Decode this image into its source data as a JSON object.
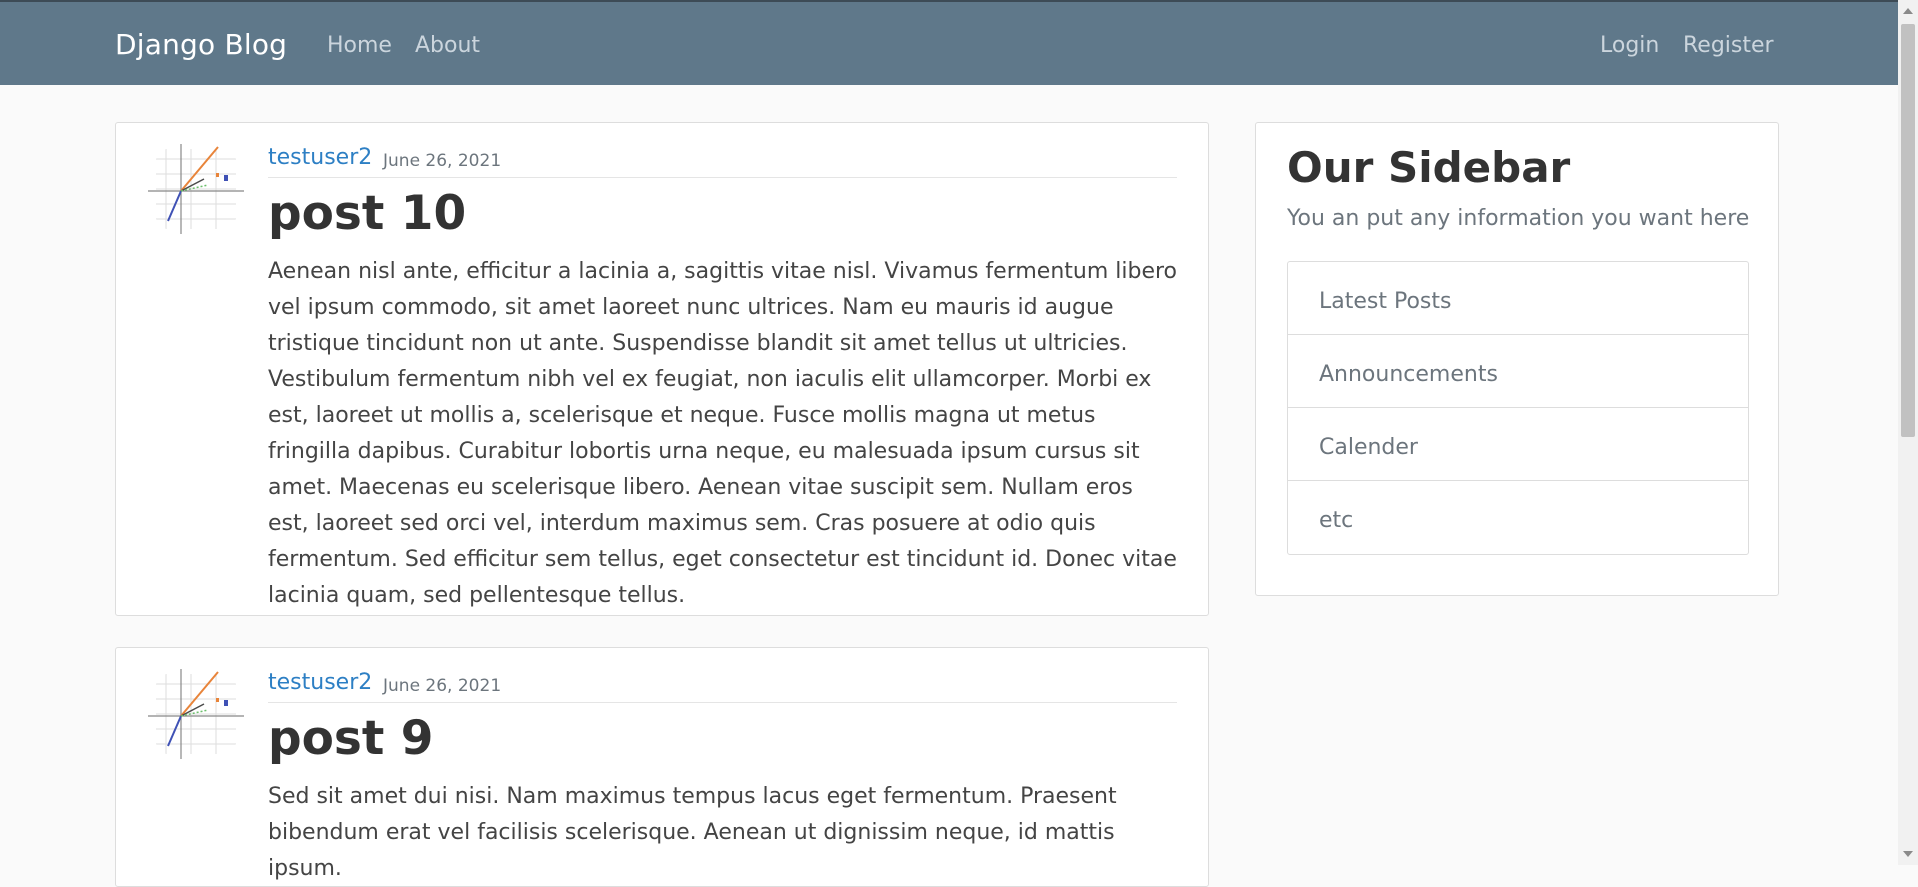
{
  "navbar": {
    "brand": "Django Blog",
    "links": [
      "Home",
      "About"
    ],
    "auth_links": [
      "Login",
      "Register"
    ]
  },
  "posts": [
    {
      "author": "testuser2",
      "date": "June 26, 2021",
      "title": "post 10",
      "content": "Aenean nisl ante, efficitur a lacinia a, sagittis vitae nisl. Vivamus fermentum libero vel ipsum commodo, sit amet laoreet nunc ultrices. Nam eu mauris id augue tristique tincidunt non ut ante. Suspendisse blandit sit amet tellus ut ultricies. Vestibulum fermentum nibh vel ex feugiat, non iaculis elit ullamcorper. Morbi ex est, laoreet ut mollis a, scelerisque et neque. Fusce mollis magna ut metus fringilla dapibus. Curabitur lobortis urna neque, eu malesuada ipsum cursus sit amet. Maecenas eu scelerisque libero. Aenean vitae suscipit sem. Nullam eros est, laoreet sed orci vel, interdum maximus sem. Cras posuere at odio quis fermentum. Sed efficitur sem tellus, eget consectetur est tincidunt id. Donec vitae lacinia quam, sed pellentesque tellus."
    },
    {
      "author": "testuser2",
      "date": "June 26, 2021",
      "title": "post 9",
      "content": "Sed sit amet dui nisi. Nam maximus tempus lacus eget fermentum. Praesent bibendum erat vel facilisis scelerisque. Aenean ut dignissim neque, id mattis ipsum."
    }
  ],
  "sidebar": {
    "title": "Our Sidebar",
    "subtitle": "You an put any information you want here",
    "items": [
      "Latest Posts",
      "Announcements",
      "Calender",
      "etc"
    ]
  },
  "icons": {
    "avatar": "avatar-graph-image"
  }
}
